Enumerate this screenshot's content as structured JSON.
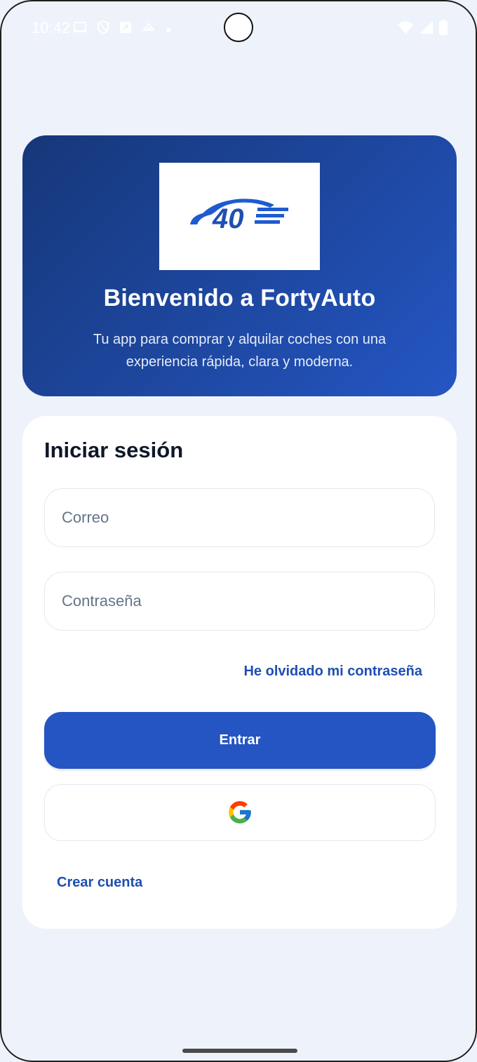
{
  "status_bar": {
    "time": "10:42",
    "left_icons": [
      "tablet-icon",
      "shield-icon",
      "app-icon",
      "sync-icon",
      "dot-icon"
    ],
    "right_icons": [
      "wifi-icon",
      "signal-icon",
      "battery-icon"
    ]
  },
  "hero": {
    "logo_text": "40",
    "title": "Bienvenido a FortyAuto",
    "subtitle": "Tu app para comprar y alquilar coches con una experiencia rápida, clara y moderna."
  },
  "login": {
    "title": "Iniciar sesión",
    "email_placeholder": "Correo",
    "email_value": "",
    "password_placeholder": "Contraseña",
    "password_value": "",
    "forgot_label": "He olvidado mi contraseña",
    "submit_label": "Entrar",
    "google_icon": "google-icon",
    "create_account_label": "Crear cuenta"
  },
  "colors": {
    "background": "#eef3fb",
    "hero_start": "#163779",
    "hero_end": "#2456c4",
    "primary": "#2455c2",
    "link": "#1e4fb1"
  }
}
